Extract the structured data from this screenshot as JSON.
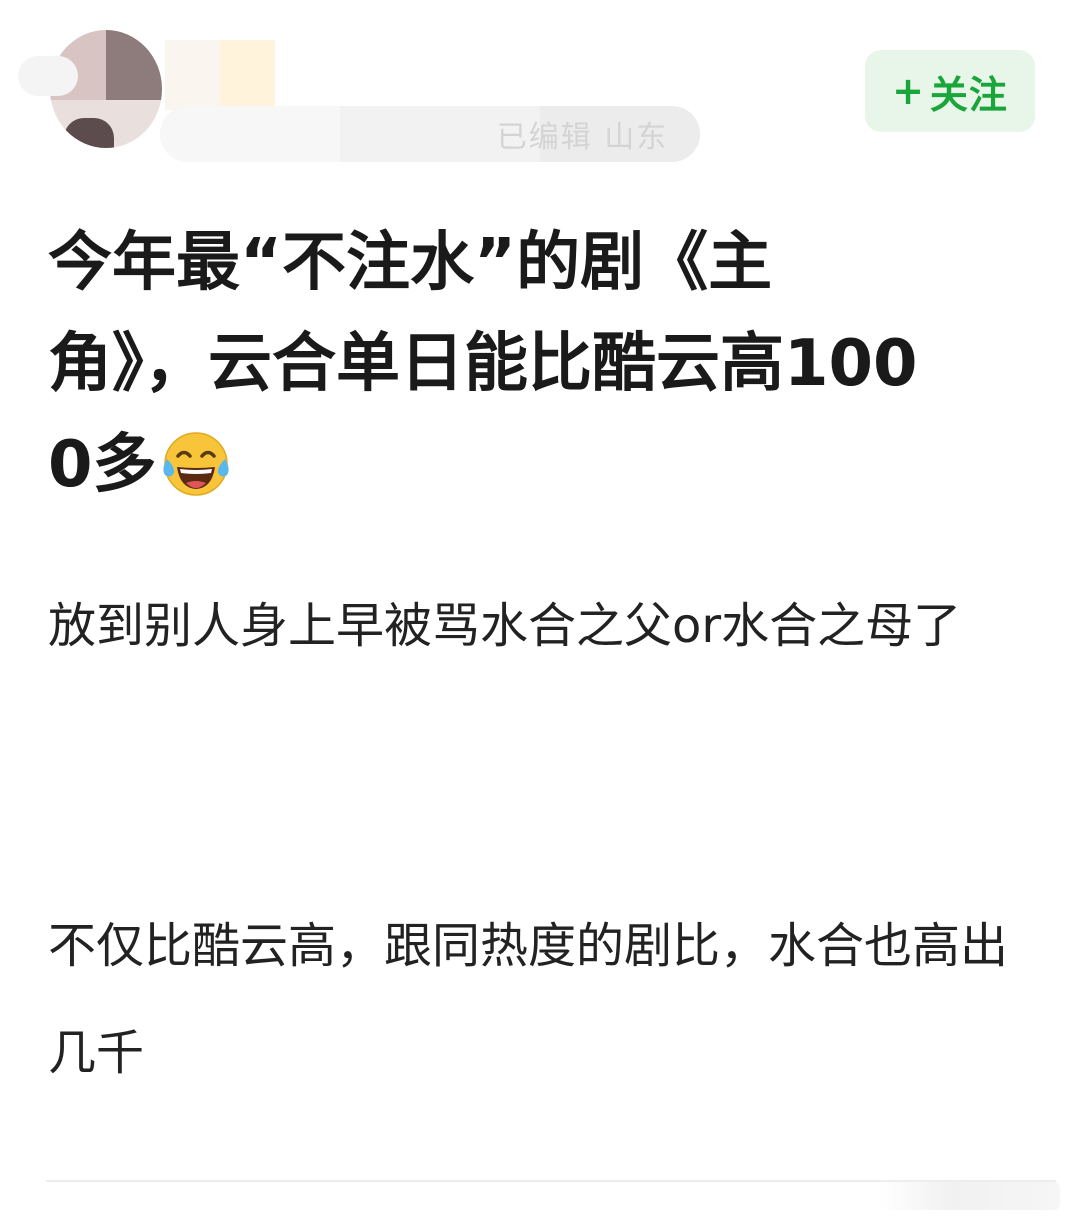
{
  "header": {
    "meta_tail": "已编辑 山东",
    "follow_button": {
      "plus": "+",
      "label": "关注"
    }
  },
  "post": {
    "title": "今年最“不注水”的剧《主角》，云合单日能比酷云高1000多",
    "title_emoji": "face-with-tears-of-joy-icon",
    "paragraphs": [
      "放到别人身上早被骂水合之父or水合之母了",
      "不仅比酷云高，跟同热度的剧比，水合也高出几千"
    ]
  },
  "colors": {
    "follow_green": "#1aa53a",
    "follow_bg": "#e8f6ea",
    "text": "#1a1a1a"
  }
}
